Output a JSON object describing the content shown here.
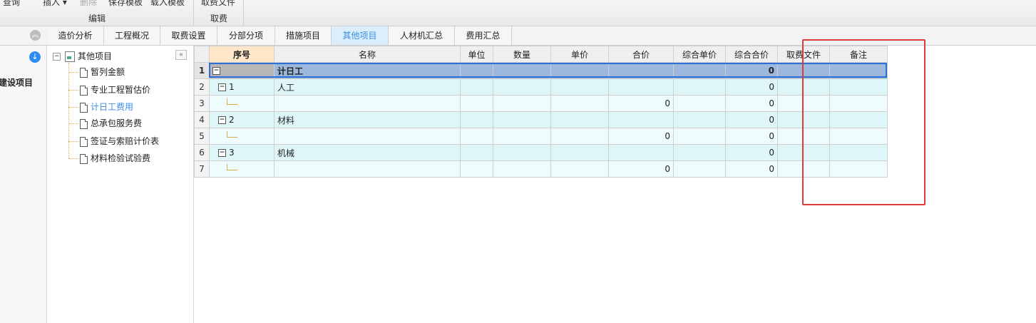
{
  "ribbon": {
    "top_buttons": [
      {
        "label": "查询",
        "disabled": false
      },
      {
        "label": "插入",
        "disabled": false
      },
      {
        "label": "删除",
        "disabled": true
      },
      {
        "label": "保存模板",
        "disabled": false
      },
      {
        "label": "载入模板",
        "disabled": false
      },
      {
        "label": "取费文件",
        "disabled": false
      }
    ],
    "groups": [
      "编辑",
      "取费"
    ]
  },
  "tabs": [
    {
      "label": "造价分析",
      "active": false
    },
    {
      "label": "工程概况",
      "active": false
    },
    {
      "label": "取费设置",
      "active": false
    },
    {
      "label": "分部分项",
      "active": false
    },
    {
      "label": "措施项目",
      "active": false
    },
    {
      "label": "其他项目",
      "active": true
    },
    {
      "label": "人材机汇总",
      "active": false
    },
    {
      "label": "费用汇总",
      "active": false
    }
  ],
  "left_panel": {
    "label": "建设项目"
  },
  "tree": {
    "root": "其他项目",
    "items": [
      {
        "label": "暂列金额",
        "selected": false
      },
      {
        "label": "专业工程暂估价",
        "selected": false
      },
      {
        "label": "计日工费用",
        "selected": true
      },
      {
        "label": "总承包服务费",
        "selected": false
      },
      {
        "label": "签证与索赔计价表",
        "selected": false
      },
      {
        "label": "材料检验试验费",
        "selected": false
      }
    ]
  },
  "grid": {
    "columns": [
      "序号",
      "名称",
      "单位",
      "数量",
      "单价",
      "合价",
      "综合单价",
      "综合合价",
      "取费文件",
      "备注"
    ],
    "rows": [
      {
        "row_no": "1",
        "seq": "",
        "name": "计日工",
        "unit": "",
        "qty": "",
        "price": "",
        "total": "",
        "unit_cost": "",
        "total_cost": "0",
        "fee_file": "",
        "note": "",
        "level": 0
      },
      {
        "row_no": "2",
        "seq": "1",
        "name": "人工",
        "unit": "",
        "qty": "",
        "price": "",
        "total": "",
        "unit_cost": "",
        "total_cost": "0",
        "fee_file": "",
        "note": "",
        "level": 1
      },
      {
        "row_no": "3",
        "seq": "",
        "name": "",
        "unit": "",
        "qty": "",
        "price": "",
        "total": "0",
        "unit_cost": "",
        "total_cost": "0",
        "fee_file": "",
        "note": "",
        "level": 2
      },
      {
        "row_no": "4",
        "seq": "2",
        "name": "材料",
        "unit": "",
        "qty": "",
        "price": "",
        "total": "",
        "unit_cost": "",
        "total_cost": "0",
        "fee_file": "",
        "note": "",
        "level": 1
      },
      {
        "row_no": "5",
        "seq": "",
        "name": "",
        "unit": "",
        "qty": "",
        "price": "",
        "total": "0",
        "unit_cost": "",
        "total_cost": "0",
        "fee_file": "",
        "note": "",
        "level": 2
      },
      {
        "row_no": "6",
        "seq": "3",
        "name": "机械",
        "unit": "",
        "qty": "",
        "price": "",
        "total": "",
        "unit_cost": "",
        "total_cost": "0",
        "fee_file": "",
        "note": "",
        "level": 1
      },
      {
        "row_no": "7",
        "seq": "",
        "name": "",
        "unit": "",
        "qty": "",
        "price": "",
        "total": "0",
        "unit_cost": "",
        "total_cost": "0",
        "fee_file": "",
        "note": "",
        "level": 2
      }
    ]
  },
  "icons": {
    "collapse": "double-chevron-up-icon",
    "download": "arrow-down-circle-icon",
    "tree_collapse": "double-chevron-left-icon",
    "document": "document-icon"
  },
  "colors": {
    "active_tab": "#3a8ee6",
    "selected_row": "#9cb8dc",
    "row_even": "#dff6f8",
    "row_odd": "#effcfd",
    "seq_header": "#fde7c8",
    "highlight_box": "#e03a3a"
  }
}
